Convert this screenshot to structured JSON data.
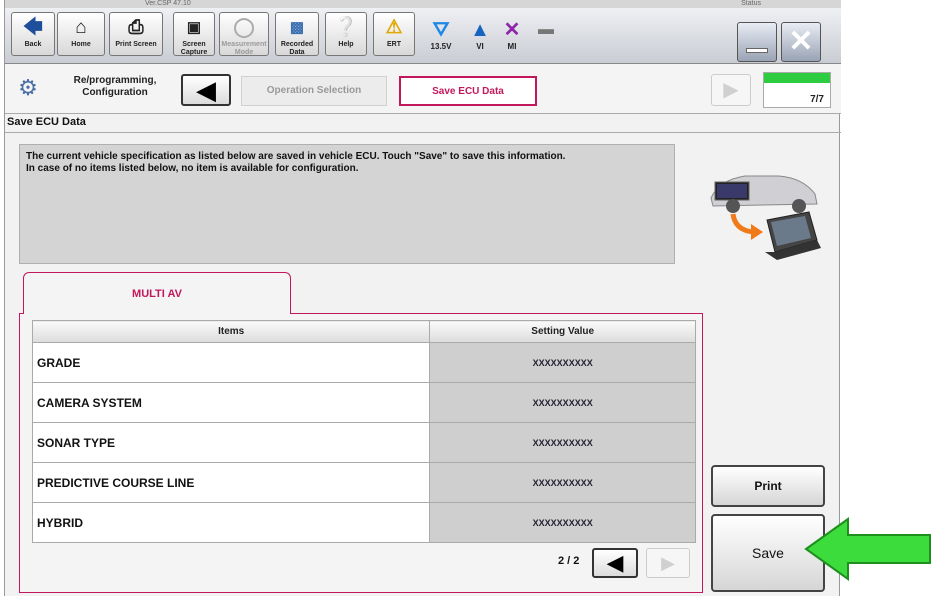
{
  "header": {
    "version_text": "Ver.CSP 47.10",
    "status_text": "Status"
  },
  "toolbar": {
    "buttons": [
      {
        "label": "Back",
        "icon": "back-arrow-icon"
      },
      {
        "label": "Home",
        "icon": "home-icon"
      },
      {
        "label": "Print Screen",
        "icon": "printer-icon"
      },
      {
        "label": "Screen Capture",
        "icon": "camera-icon"
      },
      {
        "label": "Measurement Mode",
        "icon": "meter-icon"
      },
      {
        "label": "Recorded Data",
        "icon": "recorded-data-icon"
      },
      {
        "label": "Help",
        "icon": "help-icon"
      },
      {
        "label": "ERT",
        "icon": "warning-icon"
      }
    ],
    "status": {
      "battery": "13.5V",
      "vi": "VI",
      "mi": "MI"
    }
  },
  "breadcrumb": {
    "reprogramming_label": "Re/programming, Configuration",
    "operation_selection": "Operation Selection",
    "current": "Save ECU Data",
    "progress_text": "7/7",
    "progress_fraction": 1.0
  },
  "page": {
    "section_title": "Save ECU Data",
    "info_line1": "The current vehicle specification as listed below are saved in vehicle ECU. Touch \"Save\" to save this information.",
    "info_line2": "In case of no items listed below, no item is available for configuration."
  },
  "tab": {
    "label": "MULTI AV"
  },
  "table": {
    "headers": [
      "Items",
      "Setting Value"
    ],
    "rows": [
      {
        "item": "GRADE",
        "value": "XXXXXXXXXX"
      },
      {
        "item": "CAMERA SYSTEM",
        "value": "XXXXXXXXXX"
      },
      {
        "item": "SONAR TYPE",
        "value": "XXXXXXXXXX"
      },
      {
        "item": "PREDICTIVE COURSE LINE",
        "value": "XXXXXXXXXX"
      },
      {
        "item": "HYBRID",
        "value": "XXXXXXXXXX"
      }
    ]
  },
  "pager": {
    "text": "2 / 2"
  },
  "actions": {
    "print_label": "Print",
    "save_label": "Save"
  },
  "colors": {
    "accent": "#c2185b",
    "progress": "#2ecc40",
    "callout_arrow": "#3ddc3d"
  }
}
